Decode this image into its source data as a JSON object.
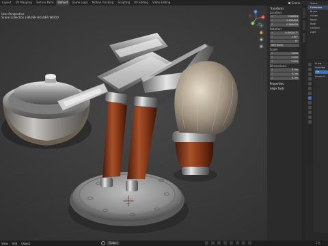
{
  "topbar": {
    "workspaces": [
      "Layout",
      "UV Mapping",
      "Texture Paint",
      "Default",
      "Game Logic",
      "Motion Tracking",
      "Scripting",
      "UV Editing",
      "Video Editing"
    ],
    "active_workspace": "Default",
    "scene_label": "Scene"
  },
  "viewport": {
    "view_name": "User Perspective",
    "collection_path": "Scene Collection | BRUSH HOLDER WOOD",
    "engraving": "3D MODEL"
  },
  "gizmo": {
    "x": "X",
    "y": "Y",
    "z": "Z"
  },
  "npanel": {
    "transform_header": "Transform",
    "location_label": "Location:",
    "location": [
      {
        "axis": "X",
        "value": "0.00818"
      },
      {
        "axis": "Y",
        "value": "0.000000"
      },
      {
        "axis": "Z",
        "value": "0.000000"
      }
    ],
    "rotation_label": "Rotation:",
    "rotation": [
      {
        "axis": "X",
        "value": "-0.000477°"
      },
      {
        "axis": "Y",
        "value": "-180°"
      },
      {
        "axis": "Z",
        "value": "0°"
      }
    ],
    "rotation_mode": "XYZ Euler",
    "scale_label": "Scale:",
    "scale": [
      {
        "axis": "X",
        "value": "1.000"
      },
      {
        "axis": "Y",
        "value": "1.000"
      },
      {
        "axis": "Z",
        "value": "1.000"
      }
    ],
    "dimensions_label": "Dimensions:",
    "dimensions": [
      {
        "axis": "X",
        "value": "0.0m"
      },
      {
        "axis": "Y",
        "value": "0.0m"
      },
      {
        "axis": "Z",
        "value": "0.0m"
      }
    ],
    "properties_header": "Properties",
    "align_tools": "Align Tools"
  },
  "outliner": {
    "rows": [
      "Scene",
      "Collection",
      "Brush",
      "Holder",
      "Razor",
      "Bowl",
      "Camera",
      "Light"
    ],
    "selected_index": 1
  },
  "properties": {
    "label_top": "Vi ew",
    "label_add": "Add Mod",
    "button_a": "Ge",
    "label_level": "Levels V"
  },
  "statusbar": {
    "left_items": [
      "View",
      "Add",
      "Object"
    ],
    "select_label": "Global",
    "version": "3.0"
  },
  "colors": {
    "accent": "#3a72c0",
    "viewport_bg": "#3b3b3b",
    "wood": "#8b3a1c",
    "chrome": "#b9b9b9"
  }
}
